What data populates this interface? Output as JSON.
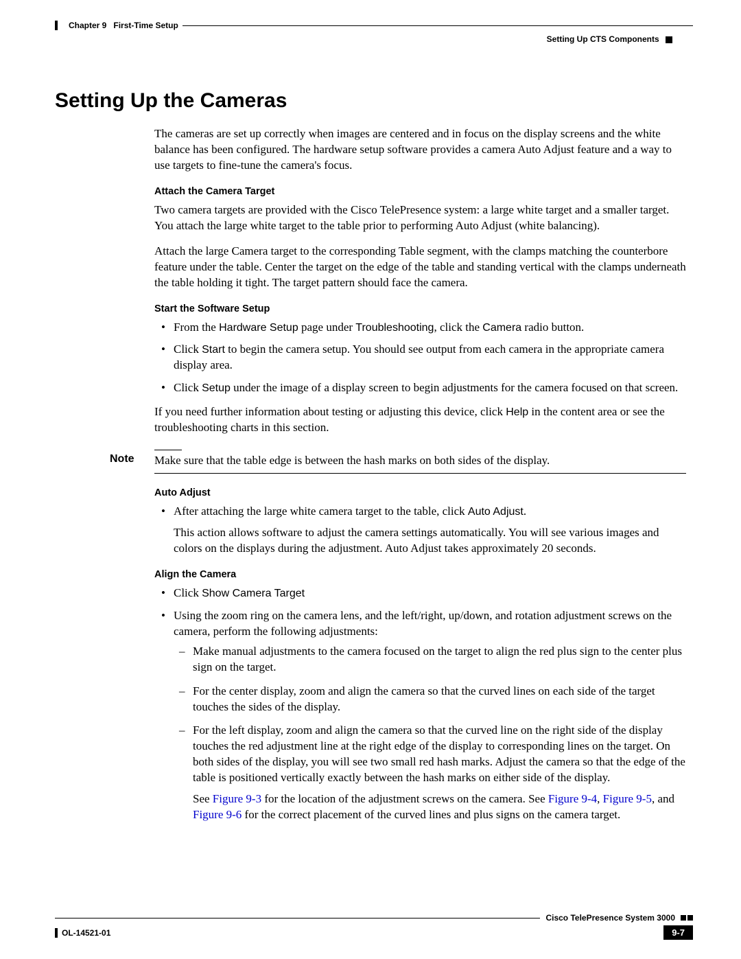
{
  "header": {
    "chapter_label": "Chapter 9",
    "chapter_title": "First-Time Setup",
    "section": "Setting Up CTS Components"
  },
  "title": "Setting Up the Cameras",
  "intro": "The cameras are set up correctly when images are centered and in focus on the display screens and the white balance has been configured. The hardware setup software provides a camera Auto Adjust feature and a way to use targets to fine-tune the camera's focus.",
  "attach": {
    "heading": "Attach the Camera Target",
    "p1": "Two camera targets are provided with the Cisco TelePresence system: a large white target and a smaller target. You attach the large white target to the table prior to performing Auto Adjust (white balancing).",
    "p2": "Attach the large Camera target to the corresponding Table segment, with the clamps matching the counterbore feature under the table. Center the target on the edge of the table and standing vertical with the clamps underneath the table holding it tight. The target pattern should face the camera."
  },
  "start": {
    "heading": "Start the Software Setup",
    "b1_pre": "From the ",
    "b1_t1": "Hardware Setup",
    "b1_mid1": " page under ",
    "b1_t2": "Troubleshooting",
    "b1_mid2": ", click the ",
    "b1_t3": "Camera",
    "b1_post": " radio button.",
    "b2_pre": "Click ",
    "b2_t1": "Start",
    "b2_post": " to begin the camera setup. You should see output from each camera in the appropriate camera display area.",
    "b3_pre": "Click ",
    "b3_t1": "Setup",
    "b3_post": " under the image of a display screen to begin adjustments for the camera focused on that screen.",
    "p_after_pre": "If you need further information about testing or adjusting this device, click ",
    "p_after_t": "Help",
    "p_after_post": " in the content area or see the troubleshooting charts in this section."
  },
  "note": {
    "label": "Note",
    "text": "Make sure that the table edge is between the hash marks on both sides of the display."
  },
  "auto": {
    "heading": "Auto Adjust",
    "b1_pre": "After attaching the large white camera target to the table, click ",
    "b1_t": "Auto Adjust",
    "b1_post": ".",
    "b1_extra": "This action allows software to adjust the camera settings automatically. You will see various images and colors on the displays during the adjustment. Auto Adjust takes approximately 20 seconds."
  },
  "align": {
    "heading": "Align the Camera",
    "b1_pre": "Click ",
    "b1_t": "Show Camera Target",
    "b2": "Using the zoom ring on the camera lens, and the left/right, up/down, and rotation adjustment screws on the camera, perform the following adjustments:",
    "d1": "Make manual adjustments to the camera focused on the target to align the red plus sign to the center plus sign on the target.",
    "d2": "For the center display, zoom and align the camera so that the curved lines on each side of the target touches the sides of the display.",
    "d3": "For the left display, zoom and align the camera so that the curved line on the right side of the display touches the red adjustment line at the right edge of the display to corresponding lines on the target. On both sides of the display, you will see two small red hash marks. Adjust the camera so that the edge of the table is positioned vertically exactly between the hash marks on either side of the display.",
    "see_pre": "See ",
    "fig93": "Figure 9-3",
    "see_mid1": " for the location of the adjustment screws on the camera. See ",
    "fig94": "Figure 9-4",
    "see_comma": ", ",
    "fig95": "Figure 9-5",
    "see_and": ", and ",
    "fig96": "Figure 9-6",
    "see_post": " for the correct placement of the curved lines and plus signs on the camera target."
  },
  "footer": {
    "product": "Cisco TelePresence System 3000",
    "doc": "OL-14521-01",
    "page": "9-7"
  }
}
